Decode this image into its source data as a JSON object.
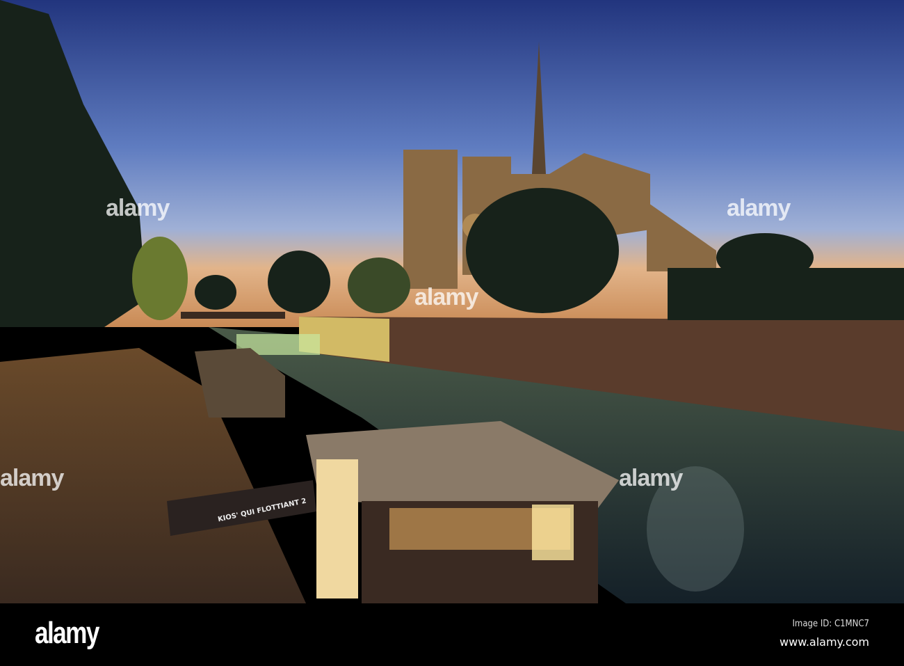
{
  "photo": {
    "boat_sign": "KIOS' QUI FLOTTIANT 2",
    "colors": {
      "sky_top": "#2a3f8a",
      "sky_bottom": "#8aa0d0",
      "horizon": "#e6b37a",
      "water": "#1c2a30",
      "wall": "#4a3428",
      "trees": "#1a2418"
    }
  },
  "watermark": {
    "text": "alamy"
  },
  "footer": {
    "logo": "alamy",
    "image_id": "Image ID: C1MNC7",
    "website": "www.alamy.com"
  }
}
